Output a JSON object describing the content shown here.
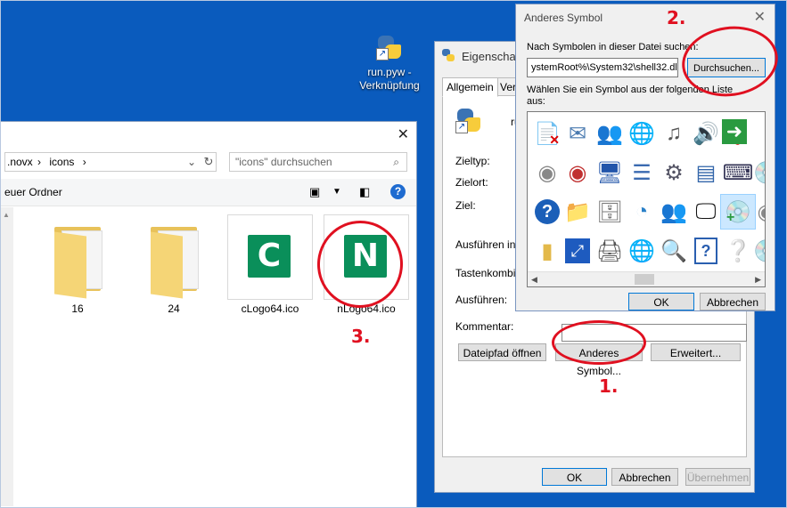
{
  "desktop": {
    "shortcut_label_line1": "run.pyw -",
    "shortcut_label_line2": "Verknüpfung"
  },
  "explorer": {
    "breadcrumb_part1": ".novx",
    "breadcrumb_sep": "›",
    "breadcrumb_part2": "icons",
    "search_placeholder": "\"icons\" durchsuchen",
    "new_folder": "euer Ordner",
    "files": [
      {
        "name": "16",
        "type": "folder"
      },
      {
        "name": "24",
        "type": "folder"
      },
      {
        "name": "cLogo64.ico",
        "type": "ico",
        "letter": "C"
      },
      {
        "name": "nLogo64.ico",
        "type": "ico",
        "letter": "N"
      }
    ],
    "badge_color": "#0a8f5a"
  },
  "properties": {
    "title": "Eigenschaft",
    "tabs": [
      "Allgemein",
      "Verk"
    ],
    "file_label": "ru",
    "fields": {
      "zieltyp": "Zieltyp:",
      "zielort": "Zielort:",
      "ziel": "Ziel:",
      "ausfuehren_in": "Ausführen in:",
      "tastenkombination": "Tastenkombina",
      "ausfuehren": "Ausführen:",
      "kommentar": "Kommentar:"
    },
    "buttons": {
      "dateipfad": "Dateipfad öffnen",
      "anderes_symbol": "Anderes Symbol...",
      "erweitert": "Erweitert...",
      "ok": "OK",
      "abbrechen": "Abbrechen",
      "uebernehmen": "Übernehmen"
    }
  },
  "change_icon_dialog": {
    "title": "Anderes Symbol",
    "search_label": "Nach Symbolen in dieser Datei suchen:",
    "path_value": "ystemRoot%\\System32\\shell32.dll",
    "browse_button": "Durchsuchen...",
    "choose_label_line1": "Wählen Sie ein Symbol aus der folgenden Liste",
    "choose_label_line2": "aus:",
    "ok": "OK",
    "cancel": "Abbrechen",
    "icons": [
      [
        "document-x-icon",
        "mail-icon",
        "users-icon",
        "network-icon",
        "music-icon",
        "speaker-icon",
        "computer-question-icon",
        "green-arrow-icon",
        "cd-icon"
      ],
      [
        "disc-gray-icon",
        "disc-red-icon",
        "monitor-color-icon",
        "list-icon",
        "window-gear-icon",
        "control-panel-icon",
        "keyboard-icon",
        "dvd-icon",
        "disc-edge-icon"
      ],
      [
        "help-icon",
        "folder-user-icon",
        "installer-icon",
        "pie-chart-icon",
        "users-pair-icon",
        "monitor-dark-icon",
        "disc-plus-icon",
        "disc-edge2-icon"
      ],
      [
        "folder-icon",
        "fullscreen-icon",
        "printer-icon",
        "globe-clock-icon",
        "search-window-icon",
        "help-page-icon",
        "disc-question-icon",
        "dvd2-icon"
      ]
    ]
  },
  "annotations": {
    "one": "1.",
    "two": "2.",
    "three": "3."
  }
}
